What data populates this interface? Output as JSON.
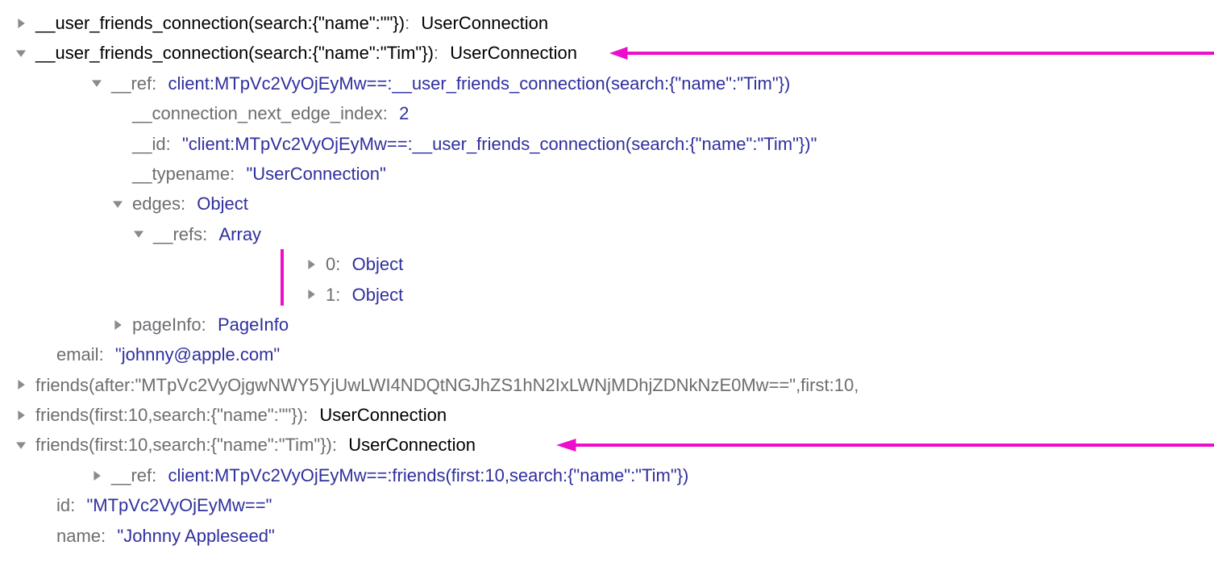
{
  "rows": {
    "r0": {
      "key": "__user_friends_connection(search:{\"name\":\"\"})",
      "value": "UserConnection"
    },
    "r1": {
      "key": "__user_friends_connection(search:{\"name\":\"Tim\"})",
      "value": "UserConnection"
    },
    "r2": {
      "key": "__ref",
      "value": "client:MTpVc2VyOjEyMw==:__user_friends_connection(search:{\"name\":\"Tim\"})"
    },
    "r3": {
      "key": "__connection_next_edge_index",
      "value": "2"
    },
    "r4": {
      "key": "__id",
      "value": "\"client:MTpVc2VyOjEyMw==:__user_friends_connection(search:{\"name\":\"Tim\"})\""
    },
    "r5": {
      "key": "__typename",
      "value": "\"UserConnection\""
    },
    "r6": {
      "key": "edges",
      "value": "Object"
    },
    "r7": {
      "key": "__refs",
      "value": "Array"
    },
    "r8": {
      "key": "0",
      "value": "Object"
    },
    "r9": {
      "key": "1",
      "value": "Object"
    },
    "r10": {
      "key": "pageInfo",
      "value": "PageInfo"
    },
    "r11": {
      "key": "email",
      "value": "\"johnny@apple.com\""
    },
    "r12": {
      "key": "friends(after:\"MTpVc2VyOjgwNWY5YjUwLWI4NDQtNGJhZS1hN2IxLWNjMDhjZDNkNzE0Mw==\",first:10,"
    },
    "r13": {
      "key": "friends(first:10,search:{\"name\":\"\"})",
      "value": "UserConnection"
    },
    "r14": {
      "key": "friends(first:10,search:{\"name\":\"Tim\"})",
      "value": "UserConnection"
    },
    "r15": {
      "key": "__ref",
      "value": "client:MTpVc2VyOjEyMw==:friends(first:10,search:{\"name\":\"Tim\"})"
    },
    "r16": {
      "key": "id",
      "value": "\"MTpVc2VyOjEyMw==\""
    },
    "r17": {
      "key": "name",
      "value": "\"Johnny Appleseed\""
    }
  },
  "colors": {
    "annotation": "#ec0ecb",
    "value": "#2f2f9e",
    "muted": "#6d6d72"
  }
}
